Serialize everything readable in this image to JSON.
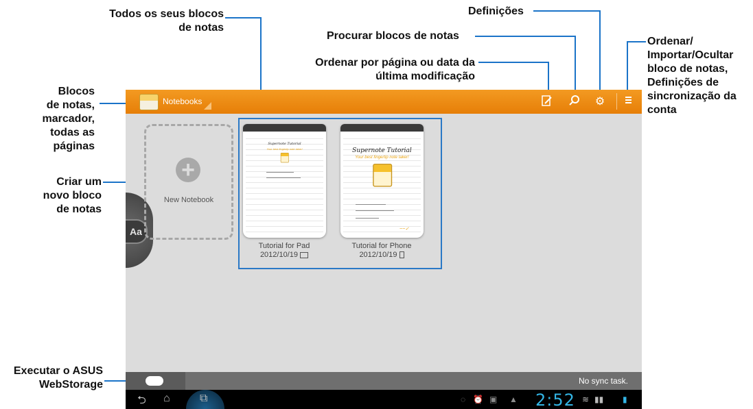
{
  "callouts": {
    "all_notebooks": [
      "Todos os seus blocos",
      "de notas"
    ],
    "settings": "Definições",
    "search": "Procurar blocos de notas",
    "sort": [
      "Ordenar por página ou data da",
      "última modificação"
    ],
    "menu": [
      "Ordenar/",
      "Importar/Ocultar",
      "bloco de notas,",
      "Definições de",
      "sincronização da",
      "conta"
    ],
    "notebooks_nav": [
      "Blocos",
      "de notas,",
      "marcador,",
      "todas as",
      "páginas"
    ],
    "create": [
      "Criar um",
      "novo bloco",
      "de notas"
    ],
    "webstorage": [
      "Executar o ASUS",
      "WebStorage"
    ]
  },
  "colors": {
    "topbar": "#f08f16",
    "callout_line": "#1a73c8",
    "clock": "#33b5e5"
  },
  "app": {
    "notebooks_label": "Notebooks",
    "new_notebook_label": "New Notebook",
    "books": [
      {
        "title": "Tutorial for Pad",
        "date": "2012/10/19",
        "device_icon": "tablet-icon",
        "page_title": "Supernote Tutorial",
        "page_sub": "Your best fingertip note taker!"
      },
      {
        "title": "Tutorial for Phone",
        "date": "2012/10/19",
        "device_icon": "phone-icon",
        "page_title": "Supernote Tutorial",
        "page_sub": "Your best fingertip note taker!"
      }
    ],
    "sync_status": "No sync task.",
    "clock": "2:52",
    "side_tab_label": "Aa"
  }
}
